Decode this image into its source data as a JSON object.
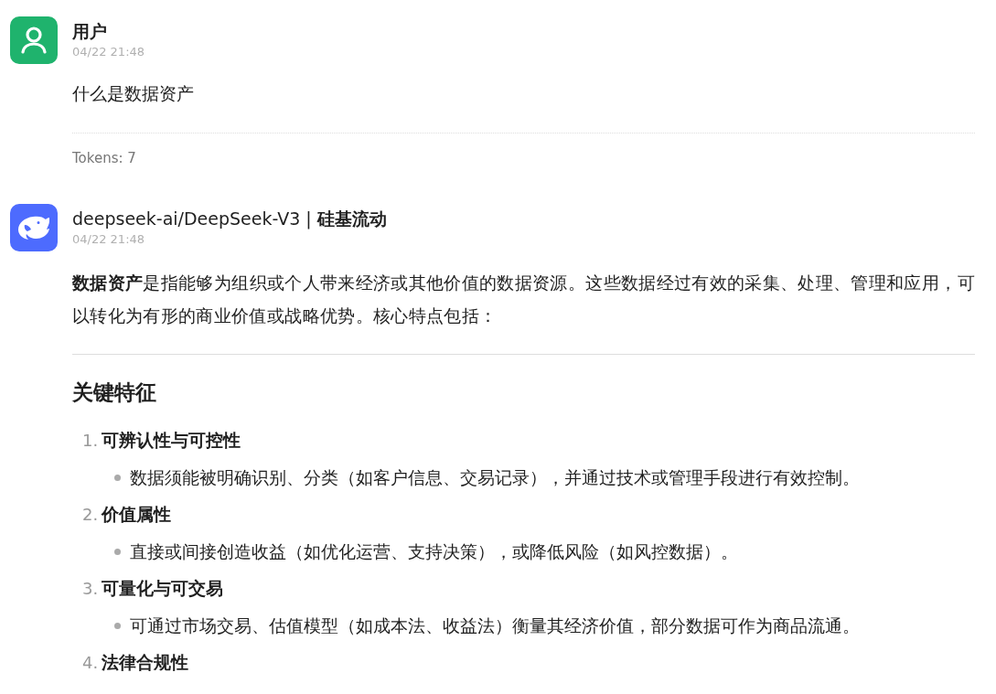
{
  "messages": [
    {
      "kind": "user",
      "name": "用户",
      "time": "04/22 21:48",
      "text": "什么是数据资产",
      "tokens": "Tokens: 7"
    },
    {
      "kind": "assistant",
      "name": "deepseek-ai/DeepSeek-V3 | **硅基流动**",
      "time": "04/22 21:48",
      "intro": "**数据资产**是指能够为组织或个人带来经济或其他价值的数据资源。这些数据经过有效的采集、处理、管理和应用，可以转化为有形的商业价值或战略优势。核心特点包括：",
      "sections": [
        {
          "heading": "关键特征",
          "items": [
            {
              "number": "1.",
              "title": "可辨认性与可控性",
              "bullets": [
                "数据须能被明确识别、分类（如客户信息、交易记录），并通过技术或管理手段进行有效控制。"
              ]
            },
            {
              "number": "2.",
              "title": "价值属性",
              "bullets": [
                "直接或间接创造收益（如优化运营、支持决策），或降低风险（如风控数据）。"
              ]
            },
            {
              "number": "3.",
              "title": "可量化与可交易",
              "bullets": [
                "可通过市场交易、估值模型（如成本法、收益法）衡量其经济价值，部分数据可作为商品流通。"
              ]
            },
            {
              "number": "4.",
              "title": "法律合规性"
            }
          ]
        }
      ]
    }
  ]
}
